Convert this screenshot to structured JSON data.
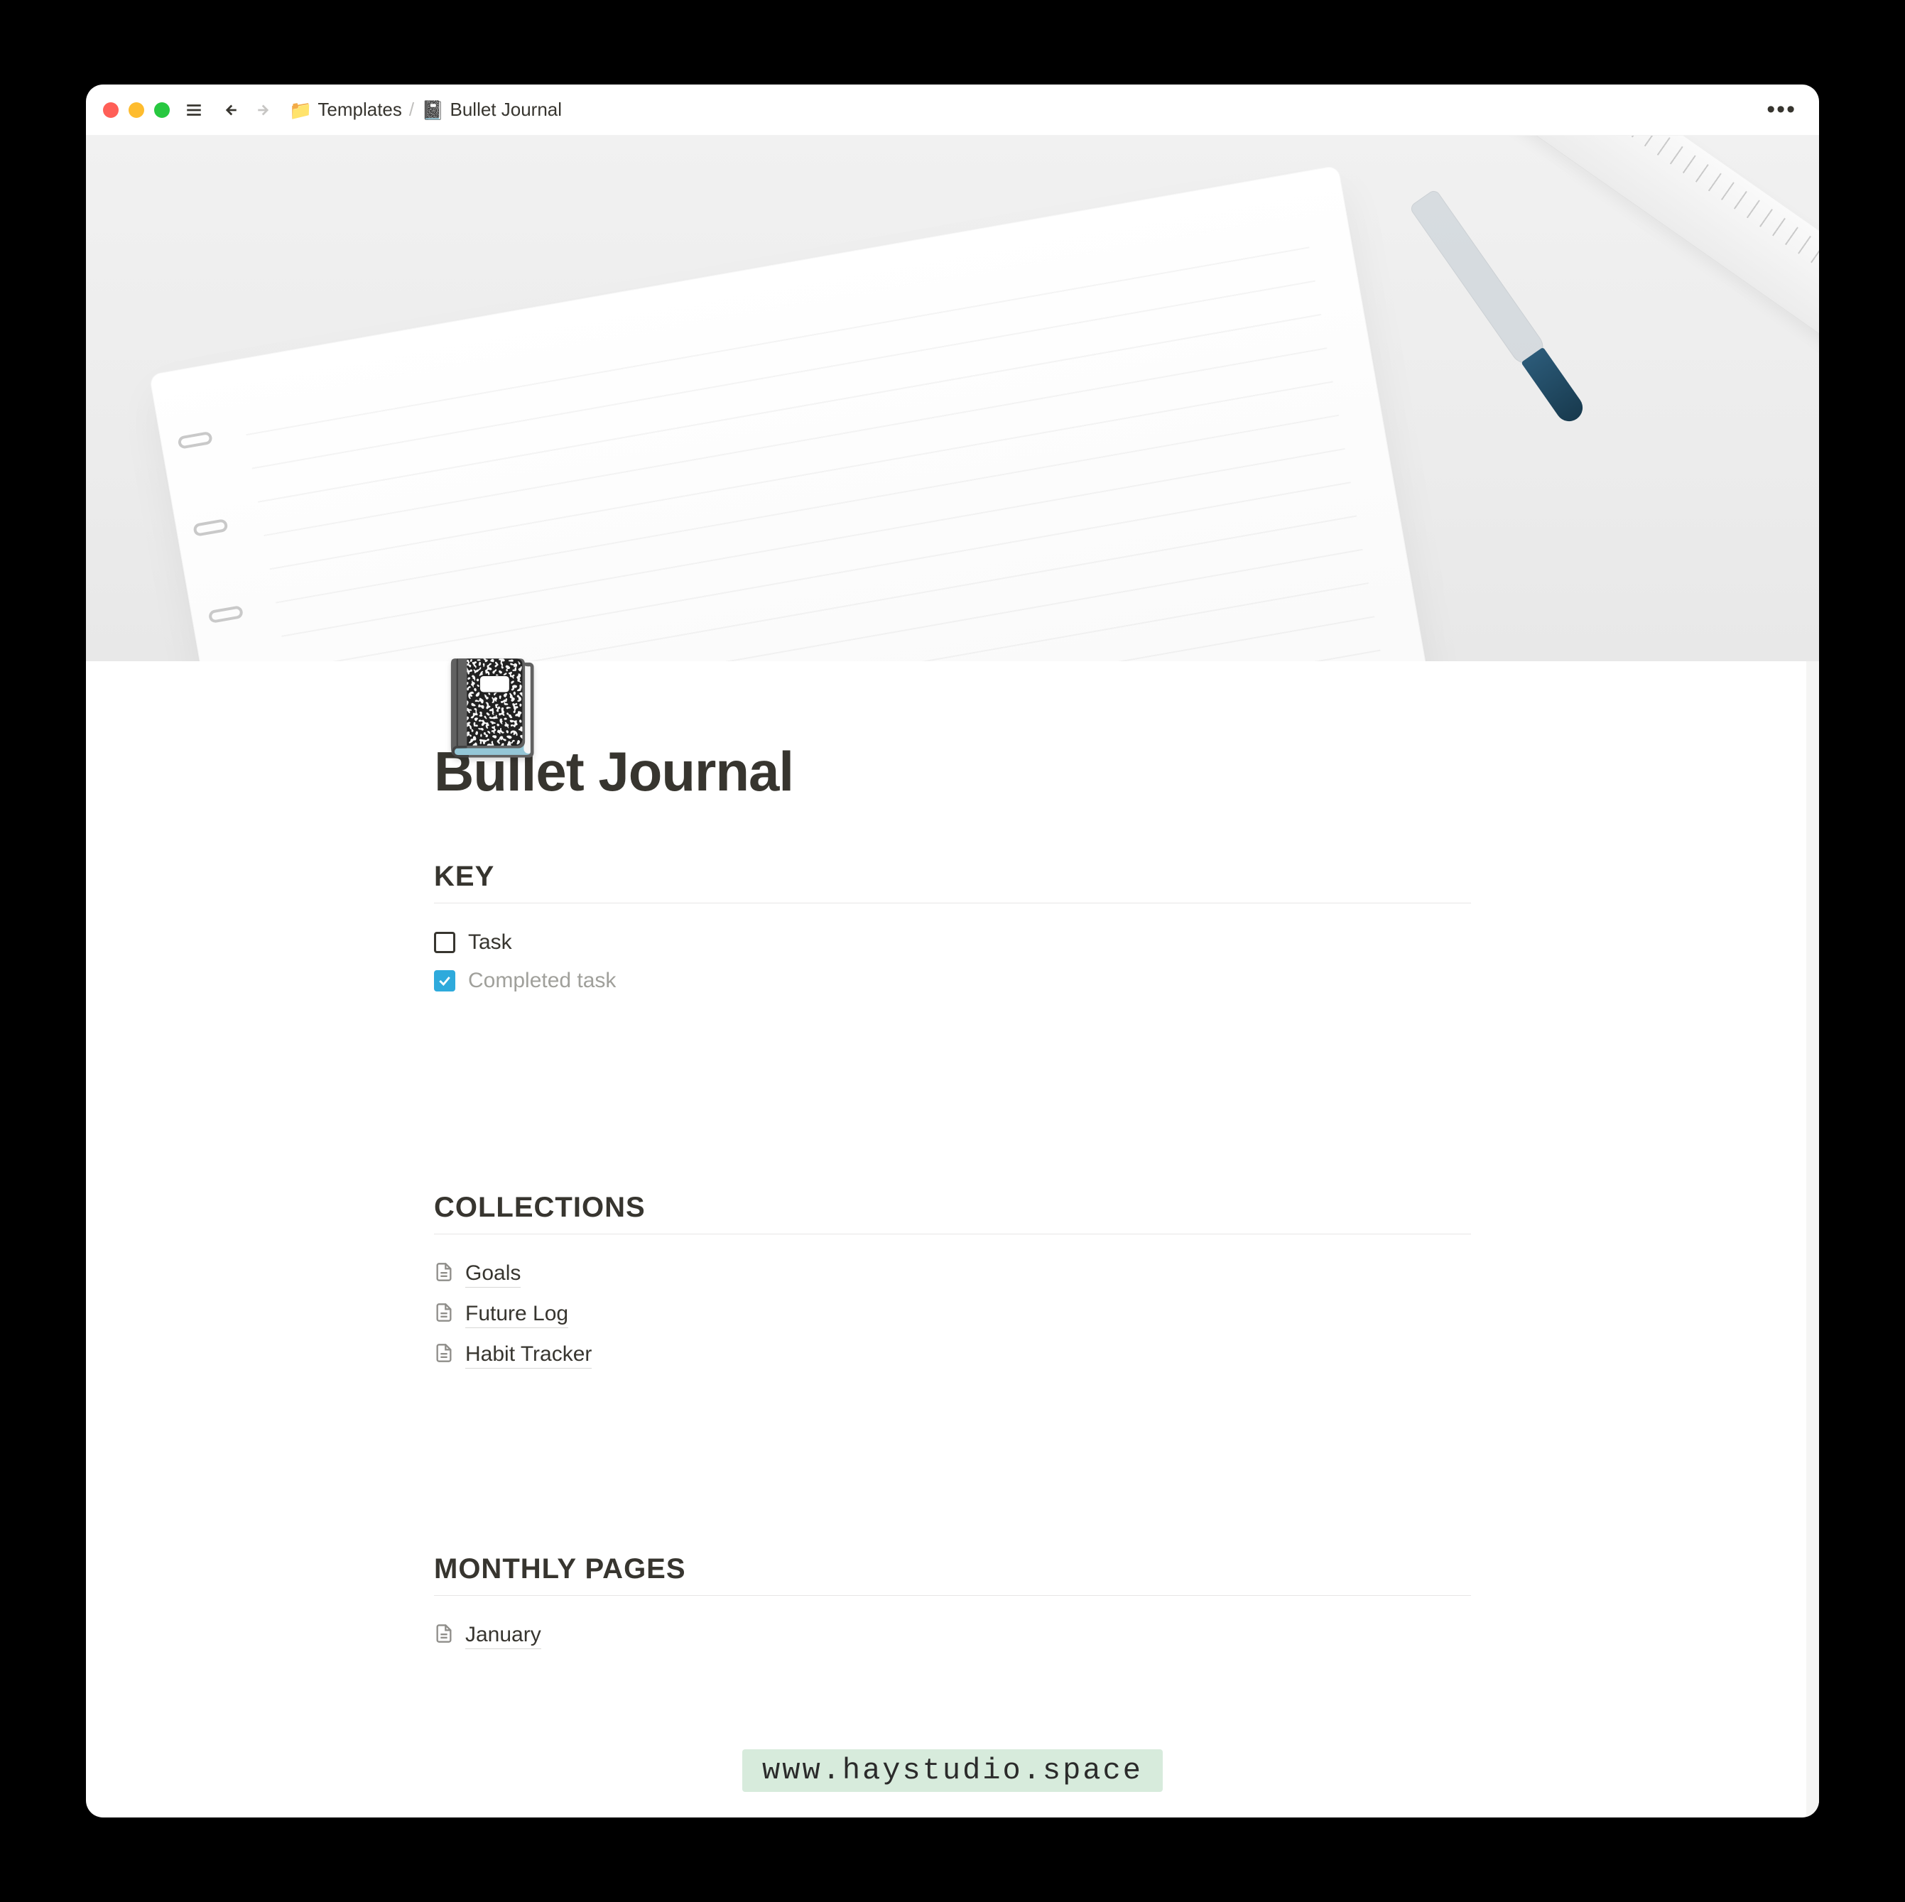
{
  "breadcrumb": {
    "parent_icon": "📁",
    "parent_label": "Templates",
    "page_icon": "📓",
    "page_label": "Bullet Journal"
  },
  "page": {
    "icon": "📓",
    "title": "Bullet Journal"
  },
  "sections": {
    "key": {
      "heading": "KEY",
      "items": [
        {
          "label": "Task",
          "checked": false
        },
        {
          "label": "Completed task",
          "checked": true
        }
      ]
    },
    "collections": {
      "heading": "COLLECTIONS",
      "items": [
        {
          "label": "Goals"
        },
        {
          "label": "Future Log"
        },
        {
          "label": "Habit Tracker"
        }
      ]
    },
    "monthly": {
      "heading": "MONTHLY PAGES",
      "items": [
        {
          "label": "January"
        }
      ]
    }
  },
  "watermark": "www.haystudio.space"
}
